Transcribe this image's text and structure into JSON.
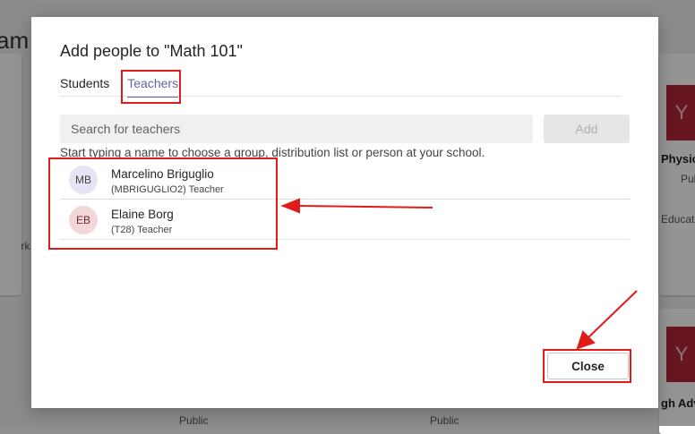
{
  "background": {
    "title_fragment": "am",
    "right_top": {
      "tile": "Y",
      "name": "Physic",
      "meta": "Pul",
      "sub": "Educatio"
    },
    "right_bottom": {
      "tile": "Y",
      "name": "gh Adv"
    },
    "left_text": "o work",
    "bottom_labels": [
      "Public",
      "Public"
    ]
  },
  "dialog": {
    "title": "Add people to \"Math 101\"",
    "tabs": [
      {
        "label": "Students",
        "active": false
      },
      {
        "label": "Teachers",
        "active": true
      }
    ],
    "search": {
      "placeholder": "Search for teachers",
      "value": ""
    },
    "add_label": "Add",
    "hint": "Start typing a name to choose a group, distribution list or person at your school.",
    "people": [
      {
        "initials": "MB",
        "name": "Marcelino Briguglio",
        "detail": "(MBRIGUGLIO2) Teacher",
        "avatar_bg": "#e6e4f2",
        "avatar_fg": "#444"
      },
      {
        "initials": "EB",
        "name": "Elaine Borg",
        "detail": "(T28) Teacher",
        "avatar_bg": "#f3d6d8",
        "avatar_fg": "#6b2b33"
      }
    ],
    "close_label": "Close"
  },
  "colors": {
    "accent": "#6264a7",
    "annotation": "#e11a1a"
  }
}
